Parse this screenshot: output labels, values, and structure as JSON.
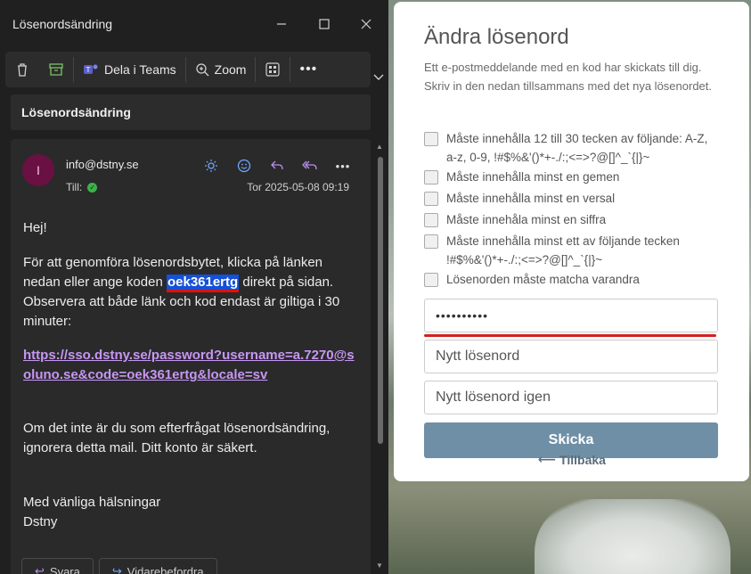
{
  "mail": {
    "window_title": "Lösenordsändring",
    "toolbar": {
      "teams_label": "Dela i Teams",
      "zoom_label": "Zoom"
    },
    "subject": "Lösenordsändring",
    "avatar_initial": "I",
    "sender": "info@dstny.se",
    "to_label": "Till:",
    "date": "Tor 2025-05-08 09:19",
    "greeting": "Hej!",
    "para1_before": "För att genomföra lösenordsbytet, klicka på länken nedan eller ange koden ",
    "code": "oek361ertg",
    "para1_after": " direkt på sidan. Observera att både länk och kod endast är giltiga i 30 minuter:",
    "link": "https://sso.dstny.se/password?username=a.7270@soluno.se&code=oek361ertg&locale=sv",
    "para2": "Om det inte är du som efterfrågat lösenordsändring, ignorera detta mail. Ditt konto är säkert.",
    "closing": "Med vänliga hälsningar",
    "signature": "Dstny",
    "reply_label": "Svara",
    "forward_label": "Vidarebefordra"
  },
  "panel": {
    "title": "Ändra lösenord",
    "intro": "Ett e-postmeddelande med en kod har skickats till dig. Skriv in den nedan tillsammans med det nya lösenordet.",
    "requirements": [
      "Måste innehålla 12 till 30 tecken av följande: A-Z, a-z, 0-9, !#$%&'()*+-./:;<=>?@[]^_`{|}~",
      "Måste innehålla minst en gemen",
      "Måste innehålla minst en versal",
      "Måste innehåla minst en siffra",
      "Måste innehålla minst ett av följande tecken !#$%&'()*+-./:;<=>?@[]^_`{|}~",
      "Lösenorden måste matcha varandra"
    ],
    "code_field_value": "••••••••••",
    "new_password_placeholder": "Nytt lösenord",
    "new_password_again_placeholder": "Nytt lösenord igen",
    "submit_label": "Skicka",
    "back_label": "Tillbaka"
  },
  "colors": {
    "code_highlight": "#1450d8",
    "link": "#c796f5",
    "submit_bg": "#6f8fa6",
    "status_green": "#3bb34a"
  }
}
